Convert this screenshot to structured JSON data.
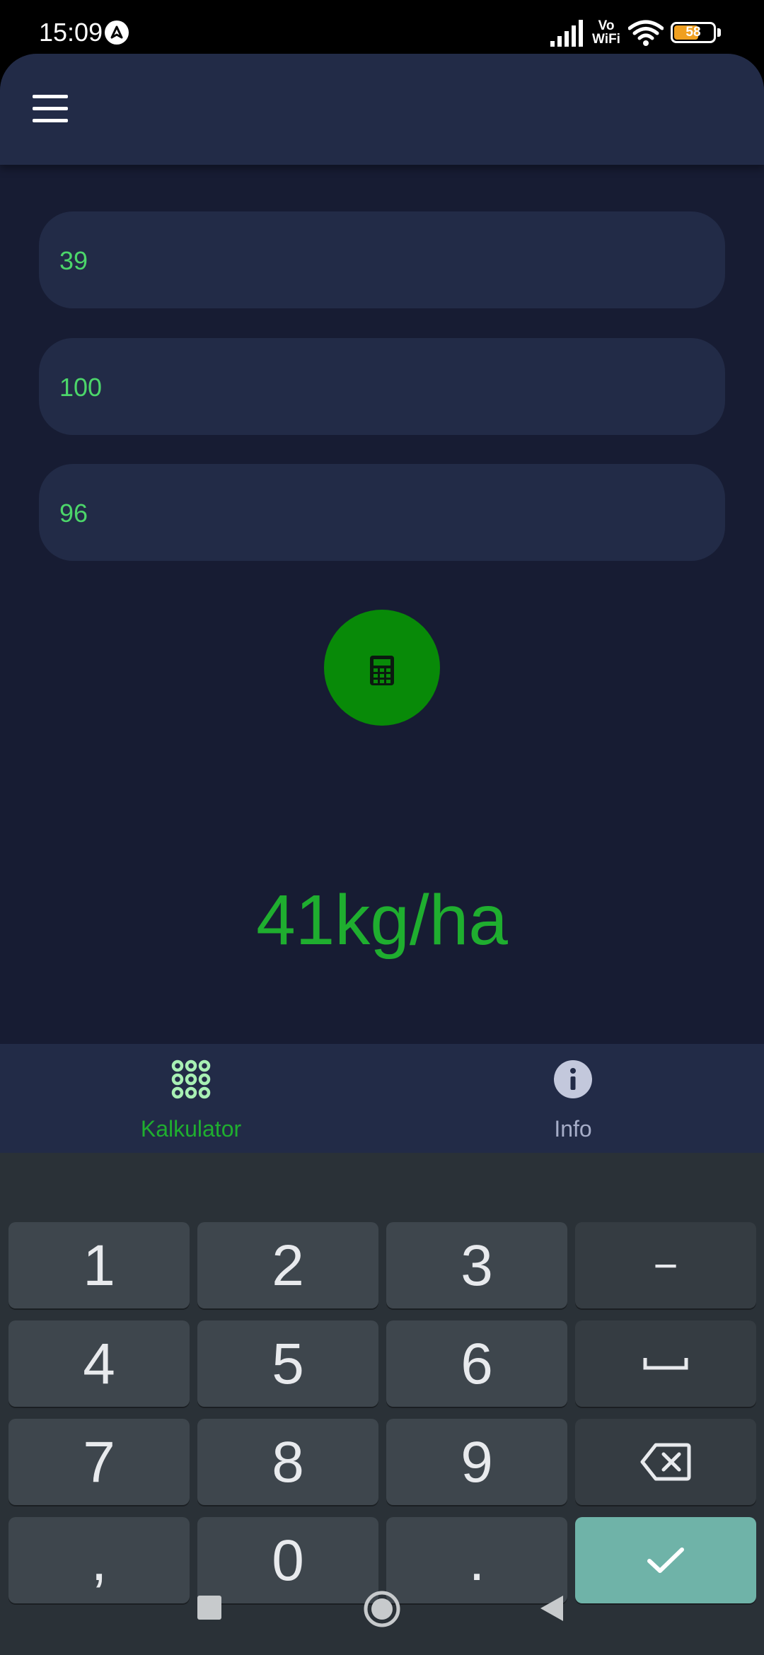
{
  "status_bar": {
    "time": "15:09",
    "network_label_top": "Vo",
    "network_label_bottom": "WiFi",
    "battery": "58"
  },
  "app_bar": {
    "menu_icon": "hamburger-menu-icon"
  },
  "inputs": [
    {
      "value": "39"
    },
    {
      "value": "100"
    },
    {
      "value": "96"
    }
  ],
  "calculate_button": {
    "icon": "calculator-icon",
    "color": "#088a08"
  },
  "result": {
    "text": "41kg/ha",
    "color": "#1fae2f"
  },
  "bottom_nav": {
    "items": [
      {
        "label": "Kalkulator",
        "icon": "grid-dots-icon",
        "active": true,
        "color": "#1fae2f"
      },
      {
        "label": "Info",
        "icon": "info-icon",
        "active": false,
        "color": "#a6adc8"
      }
    ]
  },
  "keyboard": {
    "rows": [
      [
        "1",
        "2",
        "3",
        "−"
      ],
      [
        "4",
        "5",
        "6",
        "space"
      ],
      [
        "7",
        "8",
        "9",
        "backspace"
      ],
      [
        ",",
        "0",
        ".",
        "enter"
      ]
    ],
    "labels": {
      "k1": "1",
      "k2": "2",
      "k3": "3",
      "minus": "−",
      "k4": "4",
      "k5": "5",
      "k6": "6",
      "k7": "7",
      "k8": "8",
      "k9": "9",
      "comma": ",",
      "k0": "0",
      "dot": "."
    }
  },
  "system_nav": {
    "buttons": [
      "recents",
      "home",
      "back"
    ]
  }
}
